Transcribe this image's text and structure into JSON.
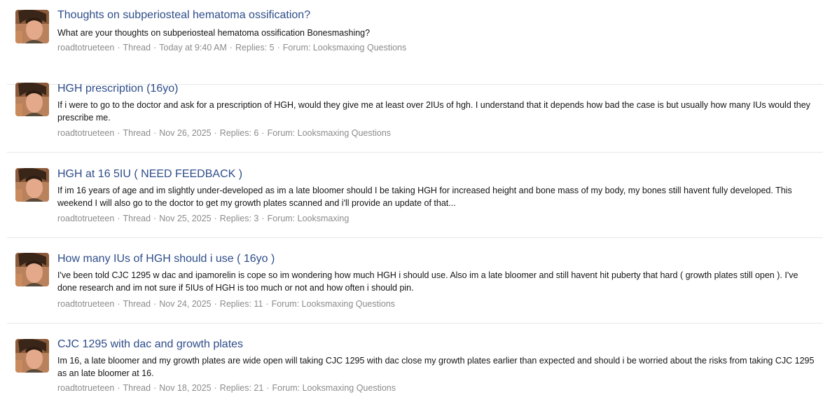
{
  "colors": {
    "title_link": "#2f4d8a",
    "snippet_text": "#141414",
    "meta_text": "#8c8c8c",
    "divider": "#e6e8eb"
  },
  "avatar_icon": "user-avatar-photo",
  "results": [
    {
      "title": "Thoughts on subperiosteal hematoma ossification?",
      "snippet": "What are your thoughts on subperiosteal hematoma ossification Bonesmashing?",
      "author": "roadtotrueteen",
      "type": "Thread",
      "date": "Today at 9:40 AM",
      "replies": "Replies: 5",
      "forum": "Forum: Looksmaxing Questions"
    },
    {
      "title": "HGH prescription (16yo)",
      "snippet": "If i were to go to the doctor and ask for a prescription of HGH, would they give me at least over 2IUs of hgh. I understand that it depends how bad the case is but usually how many IUs would they prescribe me.",
      "author": "roadtotrueteen",
      "type": "Thread",
      "date": "Nov 26, 2025",
      "replies": "Replies: 6",
      "forum": "Forum: Looksmaxing Questions"
    },
    {
      "title": "HGH at 16 5IU ( NEED FEEDBACK )",
      "snippet": "If im 16 years of age and im slightly under-developed as im a late bloomer should I be taking HGH for increased height and bone mass of my body, my bones still havent fully developed. This weekend I will also go to the doctor to get my growth plates scanned and i'll provide an update of that...",
      "author": "roadtotrueteen",
      "type": "Thread",
      "date": "Nov 25, 2025",
      "replies": "Replies: 3",
      "forum": "Forum: Looksmaxing"
    },
    {
      "title": "How many IUs of HGH should i use ( 16yo )",
      "snippet": "I've been told CJC 1295 w dac and ipamorelin is cope so im wondering how much HGH i should use. Also im a late bloomer and still havent hit puberty that hard ( growth plates still open ). I've done research and im not sure if 5IUs of HGH is too much or not and how often i should pin.",
      "author": "roadtotrueteen",
      "type": "Thread",
      "date": "Nov 24, 2025",
      "replies": "Replies: 11",
      "forum": "Forum: Looksmaxing Questions"
    },
    {
      "title": "CJC 1295 with dac and growth plates",
      "snippet": "Im 16, a late bloomer and my growth plates are wide open will taking CJC 1295 with dac close my growth plates earlier than expected and should i be worried about the risks from taking CJC 1295 as an late bloomer at 16.",
      "author": "roadtotrueteen",
      "type": "Thread",
      "date": "Nov 18, 2025",
      "replies": "Replies: 21",
      "forum": "Forum: Looksmaxing Questions"
    }
  ]
}
